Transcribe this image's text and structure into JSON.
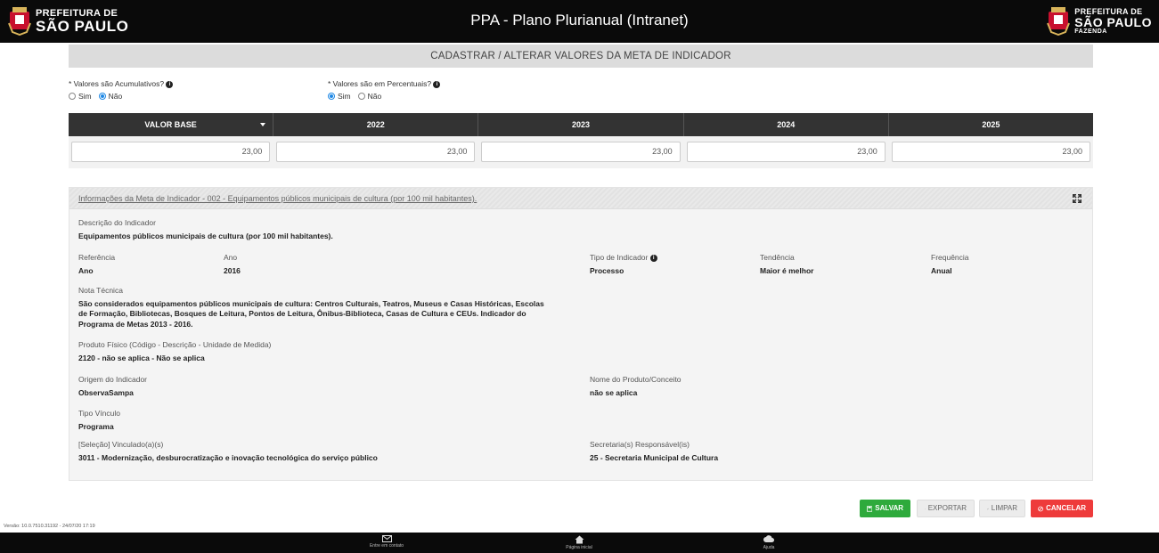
{
  "header": {
    "logo_left_line1": "PREFEITURA DE",
    "logo_left_line2": "SÃO PAULO",
    "title": "PPA - Plano Plurianual (Intranet)",
    "logo_right_line1": "PREFEITURA DE",
    "logo_right_line2": "SÃO PAULO",
    "logo_right_line3": "FAZENDA"
  },
  "page_title": "CADASTRAR / ALTERAR VALORES DA META DE INDICADOR",
  "questions": {
    "cumulative": {
      "label": "* Valores são Acumulativos?",
      "options": [
        "Sim",
        "Não"
      ],
      "selected": "Não"
    },
    "percentual": {
      "label": "* Valores são em Percentuais?",
      "options": [
        "Sim",
        "Não"
      ],
      "selected": "Sim"
    }
  },
  "value_table": {
    "columns": [
      "VALOR BASE",
      "2022",
      "2023",
      "2024",
      "2025"
    ],
    "values": [
      "23,00",
      "23,00",
      "23,00",
      "23,00",
      "23,00"
    ]
  },
  "info": {
    "title": "Informações da Meta de Indicador - 002 - Equipamentos públicos municipais de cultura (por 100 mil habitantes).",
    "descricao_label": "Descrição do Indicador",
    "descricao_value": "Equipamentos públicos municipais de cultura (por 100 mil habitantes).",
    "referencia_label": "Referência",
    "referencia_value": "Ano",
    "ano_label": "Ano",
    "ano_value": "2016",
    "tipo_label": "Tipo de Indicador",
    "tipo_value": "Processo",
    "tendencia_label": "Tendência",
    "tendencia_value": "Maior é melhor",
    "frequencia_label": "Frequência",
    "frequencia_value": "Anual",
    "nota_label": "Nota Técnica",
    "nota_line1": "São considerados equipamentos públicos municipais de cultura: Centros Culturais, Teatros, Museus e Casas Históricas, Escolas",
    "nota_line2": "de Formação, Bibliotecas, Bosques de Leitura, Pontos de Leitura, Ônibus-Biblioteca, Casas de Cultura e CEUs. Indicador do",
    "nota_line3": "Programa de Metas 2013 - 2016.",
    "produto_label": "Produto Físico (Código - Descrição - Unidade de Medida)",
    "produto_value": "2120 - não se aplica - Não se aplica",
    "origem_label": "Origem do Indicador",
    "origem_value": "ObservaSampa",
    "nome_produto_label": "Nome do Produto/Conceito",
    "nome_produto_value": "não se aplica",
    "tipo_vinculo_label": "Tipo Vínculo",
    "tipo_vinculo_value": "Programa",
    "vinculado_label": "[Seleção] Vinculado(a)(s)",
    "vinculado_value": "3011 - Modernização, desburocratização e inovação tecnológica do serviço público",
    "secretaria_label": "Secretaria(s) Responsável(is)",
    "secretaria_value": "25 - Secretaria Municipal de Cultura"
  },
  "actions": {
    "salvar": "SALVAR",
    "exportar": "EXPORTAR",
    "limpar": "LIMPAR",
    "cancelar": "CANCELAR"
  },
  "version": "Versão: 10.0.7510.31192 - 24/07/20 17:19",
  "footer": {
    "contact": "Entre em contato",
    "home": "Página inicial",
    "help": "Ajuda"
  },
  "colors": {
    "topbar": "#0a0a0a",
    "salvar": "#2eaa3c",
    "cancelar": "#ee3b3b",
    "radio_selected": "#1e88e5"
  },
  "icons": [
    "crest-icon",
    "info-icon",
    "caret-down-icon",
    "expand-icon",
    "save-icon",
    "export-icon",
    "eraser-icon",
    "cancel-icon",
    "mail-icon",
    "home-icon",
    "help-icon"
  ]
}
